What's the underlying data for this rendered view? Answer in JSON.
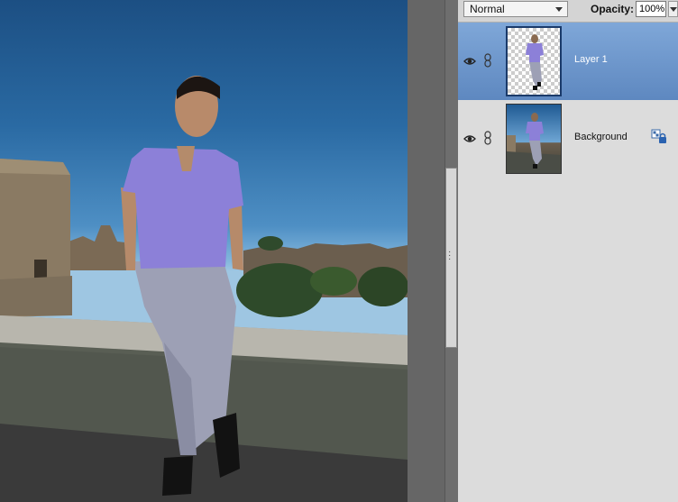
{
  "layers_panel": {
    "blend_mode": "Normal",
    "opacity_label": "Opacity:",
    "opacity_value": "100%",
    "layers": [
      {
        "name": "Layer 1",
        "selected": true,
        "visible": true,
        "locked": false,
        "thumbnail": "transparent-checker-with-person"
      },
      {
        "name": "Background",
        "selected": false,
        "visible": true,
        "locked": true,
        "thumbnail": "full-photo"
      }
    ]
  },
  "canvas": {
    "content": "photo"
  },
  "icons": {
    "visibility": "eye-icon",
    "link": "link-icon",
    "lock": "lock-icon",
    "dropdown": "chevron-down-icon"
  },
  "colors": {
    "selected_row": "#6f97cc",
    "panel_bg": "#dcdcdc",
    "shirt": "#8c80d8"
  }
}
